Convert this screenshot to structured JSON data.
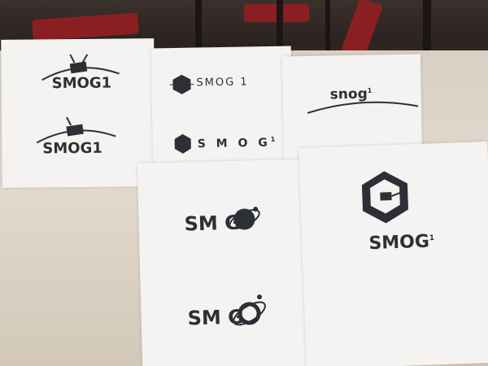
{
  "photo": {
    "subject": "printed logo concept sheets on a desk",
    "palette": {
      "paper": "#f4f3f1",
      "ink": "#2c3036",
      "desk": "#ddd4c6",
      "chair_red": "#8a1f22"
    }
  },
  "sheets": [
    {
      "logos": [
        {
          "text": "SMOG1"
        },
        {
          "text": "SMOG1"
        }
      ]
    },
    {
      "logos": [
        {
          "text": "SMOG 1"
        },
        {
          "text": "S M O G",
          "superscript": "1"
        }
      ]
    },
    {
      "logos": [
        {
          "text": "snog",
          "superscript": "1"
        }
      ]
    },
    {
      "logos": [
        {
          "text": "SM G"
        },
        {
          "text": "SM  G"
        }
      ]
    },
    {
      "logos": [
        {
          "text": "SMOG",
          "superscript": "1"
        }
      ]
    }
  ]
}
